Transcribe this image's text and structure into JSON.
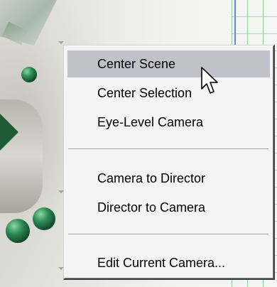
{
  "context_menu": {
    "items": [
      {
        "label": "Center Scene",
        "highlighted": true
      },
      {
        "label": "Center Selection",
        "highlighted": false
      },
      {
        "label": "Eye-Level Camera",
        "highlighted": false
      },
      {
        "label": "Camera to Director",
        "highlighted": false
      },
      {
        "label": "Director to Camera",
        "highlighted": false
      },
      {
        "label": "Edit Current Camera...",
        "highlighted": false
      }
    ]
  },
  "colors": {
    "menu_background": "#f4f4f4",
    "highlight": "#c1c1c9",
    "viewport_sphere_green": "#2f8b55",
    "viewport_grid_green": "#78c878"
  },
  "icons": {
    "cursor": "arrow-pointer-icon"
  }
}
